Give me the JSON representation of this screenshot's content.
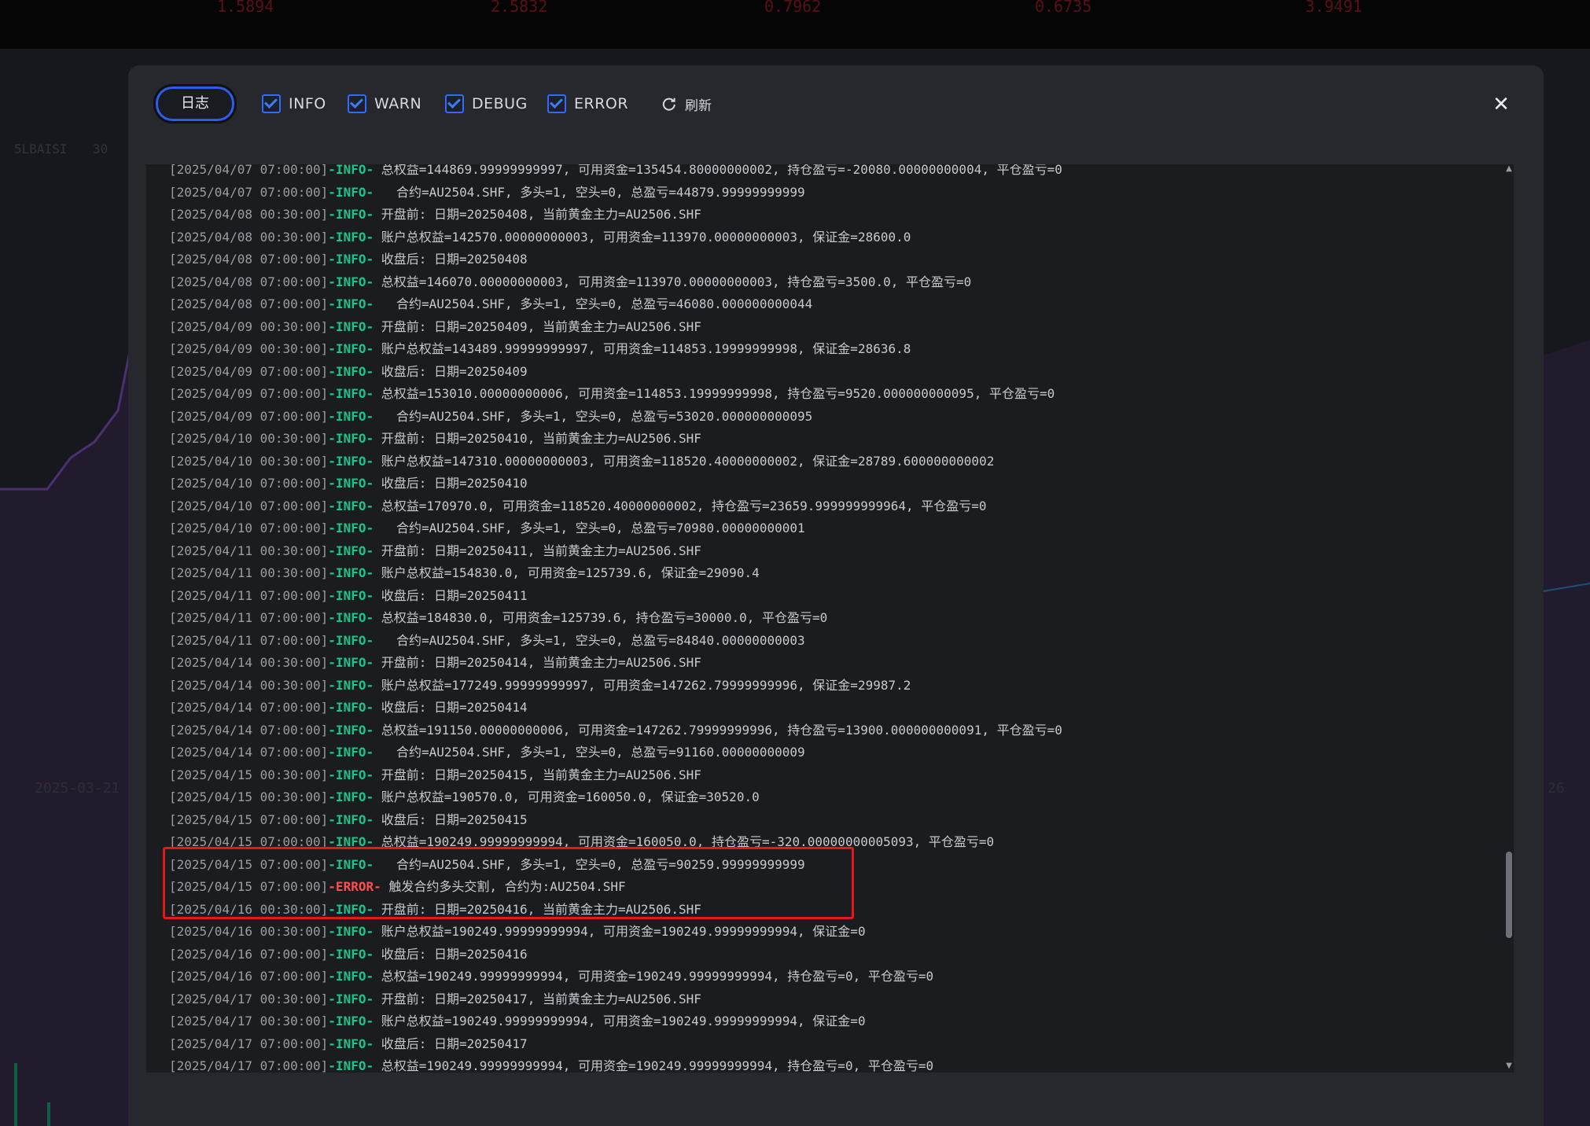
{
  "background": {
    "top_numbers": [
      "1.5894",
      "2.5832",
      "0.7962",
      "0.6735",
      "3.9491"
    ],
    "chips": [
      "5LBAISI",
      "30"
    ],
    "axis_date": "2025-03-21",
    "axis_right": "26"
  },
  "toolbar": {
    "log_tab_label": "日志",
    "filters": [
      {
        "label": "INFO",
        "checked": true
      },
      {
        "label": "WARN",
        "checked": true
      },
      {
        "label": "DEBUG",
        "checked": true
      },
      {
        "label": "ERROR",
        "checked": true
      }
    ],
    "refresh_label": "刷新",
    "close_label": "✕"
  },
  "log": {
    "lines": [
      {
        "ts": "[2025/04/07 07:00:00]",
        "level": "-INFO-",
        "msg": " 总权益=144869.99999999997, 可用资金=135454.80000000002, 持仓盈亏=-20080.00000000004, 平仓盈亏=0"
      },
      {
        "ts": "[2025/04/07 07:00:00]",
        "level": "-INFO-",
        "msg": "   合约=AU2504.SHF, 多头=1, 空头=0, 总盈亏=44879.99999999999"
      },
      {
        "ts": "[2025/04/08 00:30:00]",
        "level": "-INFO-",
        "msg": " 开盘前: 日期=20250408, 当前黄金主力=AU2506.SHF"
      },
      {
        "ts": "[2025/04/08 00:30:00]",
        "level": "-INFO-",
        "msg": " 账户总权益=142570.00000000003, 可用资金=113970.00000000003, 保证金=28600.0"
      },
      {
        "ts": "[2025/04/08 07:00:00]",
        "level": "-INFO-",
        "msg": " 收盘后: 日期=20250408"
      },
      {
        "ts": "[2025/04/08 07:00:00]",
        "level": "-INFO-",
        "msg": " 总权益=146070.00000000003, 可用资金=113970.00000000003, 持仓盈亏=3500.0, 平仓盈亏=0"
      },
      {
        "ts": "[2025/04/08 07:00:00]",
        "level": "-INFO-",
        "msg": "   合约=AU2504.SHF, 多头=1, 空头=0, 总盈亏=46080.000000000044"
      },
      {
        "ts": "[2025/04/09 00:30:00]",
        "level": "-INFO-",
        "msg": " 开盘前: 日期=20250409, 当前黄金主力=AU2506.SHF"
      },
      {
        "ts": "[2025/04/09 00:30:00]",
        "level": "-INFO-",
        "msg": " 账户总权益=143489.99999999997, 可用资金=114853.19999999998, 保证金=28636.8"
      },
      {
        "ts": "[2025/04/09 07:00:00]",
        "level": "-INFO-",
        "msg": " 收盘后: 日期=20250409"
      },
      {
        "ts": "[2025/04/09 07:00:00]",
        "level": "-INFO-",
        "msg": " 总权益=153010.00000000006, 可用资金=114853.19999999998, 持仓盈亏=9520.000000000095, 平仓盈亏=0"
      },
      {
        "ts": "[2025/04/09 07:00:00]",
        "level": "-INFO-",
        "msg": "   合约=AU2504.SHF, 多头=1, 空头=0, 总盈亏=53020.000000000095"
      },
      {
        "ts": "[2025/04/10 00:30:00]",
        "level": "-INFO-",
        "msg": " 开盘前: 日期=20250410, 当前黄金主力=AU2506.SHF"
      },
      {
        "ts": "[2025/04/10 00:30:00]",
        "level": "-INFO-",
        "msg": " 账户总权益=147310.00000000003, 可用资金=118520.40000000002, 保证金=28789.600000000002"
      },
      {
        "ts": "[2025/04/10 07:00:00]",
        "level": "-INFO-",
        "msg": " 收盘后: 日期=20250410"
      },
      {
        "ts": "[2025/04/10 07:00:00]",
        "level": "-INFO-",
        "msg": " 总权益=170970.0, 可用资金=118520.40000000002, 持仓盈亏=23659.999999999964, 平仓盈亏=0"
      },
      {
        "ts": "[2025/04/10 07:00:00]",
        "level": "-INFO-",
        "msg": "   合约=AU2504.SHF, 多头=1, 空头=0, 总盈亏=70980.00000000001"
      },
      {
        "ts": "[2025/04/11 00:30:00]",
        "level": "-INFO-",
        "msg": " 开盘前: 日期=20250411, 当前黄金主力=AU2506.SHF"
      },
      {
        "ts": "[2025/04/11 00:30:00]",
        "level": "-INFO-",
        "msg": " 账户总权益=154830.0, 可用资金=125739.6, 保证金=29090.4"
      },
      {
        "ts": "[2025/04/11 07:00:00]",
        "level": "-INFO-",
        "msg": " 收盘后: 日期=20250411"
      },
      {
        "ts": "[2025/04/11 07:00:00]",
        "level": "-INFO-",
        "msg": " 总权益=184830.0, 可用资金=125739.6, 持仓盈亏=30000.0, 平仓盈亏=0"
      },
      {
        "ts": "[2025/04/11 07:00:00]",
        "level": "-INFO-",
        "msg": "   合约=AU2504.SHF, 多头=1, 空头=0, 总盈亏=84840.00000000003"
      },
      {
        "ts": "[2025/04/14 00:30:00]",
        "level": "-INFO-",
        "msg": " 开盘前: 日期=20250414, 当前黄金主力=AU2506.SHF"
      },
      {
        "ts": "[2025/04/14 00:30:00]",
        "level": "-INFO-",
        "msg": " 账户总权益=177249.99999999997, 可用资金=147262.79999999996, 保证金=29987.2"
      },
      {
        "ts": "[2025/04/14 07:00:00]",
        "level": "-INFO-",
        "msg": " 收盘后: 日期=20250414"
      },
      {
        "ts": "[2025/04/14 07:00:00]",
        "level": "-INFO-",
        "msg": " 总权益=191150.00000000006, 可用资金=147262.79999999996, 持仓盈亏=13900.000000000091, 平仓盈亏=0"
      },
      {
        "ts": "[2025/04/14 07:00:00]",
        "level": "-INFO-",
        "msg": "   合约=AU2504.SHF, 多头=1, 空头=0, 总盈亏=91160.00000000009"
      },
      {
        "ts": "[2025/04/15 00:30:00]",
        "level": "-INFO-",
        "msg": " 开盘前: 日期=20250415, 当前黄金主力=AU2506.SHF"
      },
      {
        "ts": "[2025/04/15 00:30:00]",
        "level": "-INFO-",
        "msg": " 账户总权益=190570.0, 可用资金=160050.0, 保证金=30520.0"
      },
      {
        "ts": "[2025/04/15 07:00:00]",
        "level": "-INFO-",
        "msg": " 收盘后: 日期=20250415"
      },
      {
        "ts": "[2025/04/15 07:00:00]",
        "level": "-INFO-",
        "msg": " 总权益=190249.99999999994, 可用资金=160050.0, 持仓盈亏=-320.00000000005093, 平仓盈亏=0"
      },
      {
        "ts": "[2025/04/15 07:00:00]",
        "level": "-INFO-",
        "msg": "   合约=AU2504.SHF, 多头=1, 空头=0, 总盈亏=90259.99999999999"
      },
      {
        "ts": "[2025/04/15 07:00:00]",
        "level": "-ERROR-",
        "msg": " 触发合约多头交割, 合约为:AU2504.SHF"
      },
      {
        "ts": "[2025/04/16 00:30:00]",
        "level": "-INFO-",
        "msg": " 开盘前: 日期=20250416, 当前黄金主力=AU2506.SHF"
      },
      {
        "ts": "[2025/04/16 00:30:00]",
        "level": "-INFO-",
        "msg": " 账户总权益=190249.99999999994, 可用资金=190249.99999999994, 保证金=0"
      },
      {
        "ts": "[2025/04/16 07:00:00]",
        "level": "-INFO-",
        "msg": " 收盘后: 日期=20250416"
      },
      {
        "ts": "[2025/04/16 07:00:00]",
        "level": "-INFO-",
        "msg": " 总权益=190249.99999999994, 可用资金=190249.99999999994, 持仓盈亏=0, 平仓盈亏=0"
      },
      {
        "ts": "[2025/04/17 00:30:00]",
        "level": "-INFO-",
        "msg": " 开盘前: 日期=20250417, 当前黄金主力=AU2506.SHF"
      },
      {
        "ts": "[2025/04/17 00:30:00]",
        "level": "-INFO-",
        "msg": " 账户总权益=190249.99999999994, 可用资金=190249.99999999994, 保证金=0"
      },
      {
        "ts": "[2025/04/17 07:00:00]",
        "level": "-INFO-",
        "msg": " 收盘后: 日期=20250417"
      },
      {
        "ts": "[2025/04/17 07:00:00]",
        "level": "-INFO-",
        "msg": " 总权益=190249.99999999994, 可用资金=190249.99999999994, 持仓盈亏=0, 平仓盈亏=0"
      }
    ],
    "scroll_position": 0.78
  },
  "colors": {
    "info": "#16c68c",
    "error": "#ff4d4d",
    "accent": "#2f6bff",
    "highlight": "#e0191b"
  }
}
